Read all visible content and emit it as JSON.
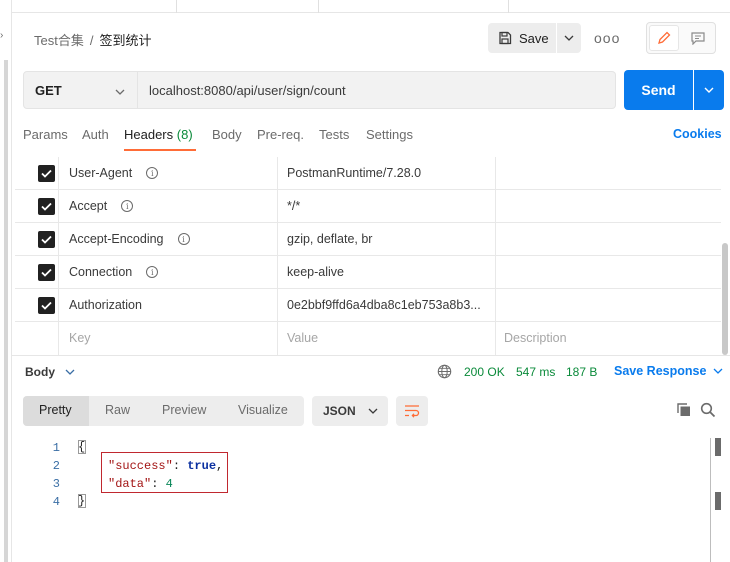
{
  "breadcrumb": {
    "collection": "Test合集",
    "separator": "/",
    "request": "签到统计"
  },
  "toolbar": {
    "save_label": "Save",
    "more_label": "ooo"
  },
  "request": {
    "method": "GET",
    "url": "localhost:8080/api/user/sign/count",
    "send_label": "Send"
  },
  "tabs": [
    {
      "label": "Params"
    },
    {
      "label": "Auth"
    },
    {
      "label": "Headers",
      "count": "(8)"
    },
    {
      "label": "Body"
    },
    {
      "label": "Pre-req."
    },
    {
      "label": "Tests"
    },
    {
      "label": "Settings"
    }
  ],
  "active_tab": "Headers",
  "cookies_label": "Cookies",
  "headers": [
    {
      "key": "User-Agent",
      "value": "PostmanRuntime/7.28.0",
      "checked": true,
      "info": true
    },
    {
      "key": "Accept",
      "value": "*/*",
      "checked": true,
      "info": true
    },
    {
      "key": "Accept-Encoding",
      "value": "gzip, deflate, br",
      "checked": true,
      "info": true
    },
    {
      "key": "Connection",
      "value": "keep-alive",
      "checked": true,
      "info": true
    },
    {
      "key": "Authorization",
      "value": "0e2bbf9ffd6a4dba8c1eb753a8b3...",
      "checked": true,
      "info": false
    }
  ],
  "header_placeholders": {
    "key": "Key",
    "value": "Value",
    "description": "Description"
  },
  "response": {
    "body_label": "Body",
    "status": "200 OK",
    "time": "547 ms",
    "size": "187 B",
    "save_label": "Save Response",
    "view_modes": [
      "Pretty",
      "Raw",
      "Preview",
      "Visualize"
    ],
    "active_view": "Pretty",
    "format": "JSON"
  },
  "code": {
    "line_numbers": [
      "1",
      "2",
      "3",
      "4"
    ],
    "open_brace": "{",
    "close_brace": "}",
    "line2_key": "\"success\"",
    "line2_sep": ": ",
    "line2_value": "true",
    "line2_end": ",",
    "line3_key": "\"data\"",
    "line3_sep": ": ",
    "line3_value": "4"
  },
  "colors": {
    "accent": "#097bed",
    "active_tab_underline": "#ff6c37",
    "success": "#0a8a3a",
    "highlight_box": "#c0282f"
  }
}
